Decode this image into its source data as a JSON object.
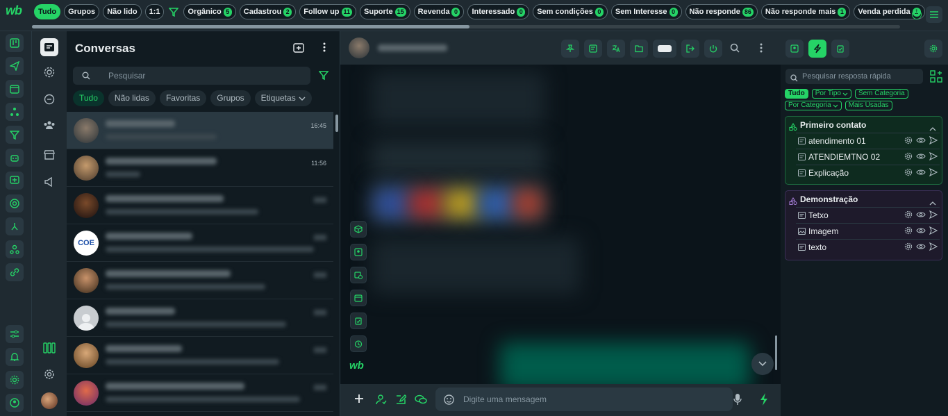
{
  "topbar": {
    "logo": "wb",
    "chips": [
      {
        "label": "Tudo",
        "count": "",
        "active": true
      },
      {
        "label": "Grupos",
        "count": ""
      },
      {
        "label": "Não lido",
        "count": ""
      },
      {
        "label": "1:1",
        "count": ""
      },
      {
        "label": "Orgânico",
        "count": "5"
      },
      {
        "label": "Cadastrou",
        "count": "2"
      },
      {
        "label": "Follow up",
        "count": "11"
      },
      {
        "label": "Suporte",
        "count": "15"
      },
      {
        "label": "Revenda",
        "count": "0"
      },
      {
        "label": "Interessado",
        "count": "0"
      },
      {
        "label": "Sem condições",
        "count": "0"
      },
      {
        "label": "Sem Interesse",
        "count": "0"
      },
      {
        "label": "Não responde",
        "count": "86"
      },
      {
        "label": "Não responde mais",
        "count": "1"
      },
      {
        "label": "Venda perdida",
        "count": "1"
      }
    ]
  },
  "conversations": {
    "title": "Conversas",
    "search_placeholder": "Pesquisar",
    "tabs": [
      {
        "label": "Tudo",
        "active": true
      },
      {
        "label": "Não lidas"
      },
      {
        "label": "Favoritas"
      },
      {
        "label": "Grupos"
      },
      {
        "label": "Etiquetas",
        "dropdown": true
      }
    ],
    "items": [
      {
        "time": "16:45",
        "selected": true,
        "w1": 100,
        "w2": 160
      },
      {
        "time": "11:56",
        "w1": 160,
        "w2": 50
      },
      {
        "time": "",
        "w1": 170,
        "w2": 220
      },
      {
        "time": "",
        "w1": 125,
        "w2": 300,
        "avatar_text": "COE"
      },
      {
        "time": "",
        "w1": 180,
        "w2": 230
      },
      {
        "time": "",
        "w1": 100,
        "w2": 260
      },
      {
        "time": "",
        "w1": 110,
        "w2": 250
      },
      {
        "time": "",
        "w1": 200,
        "w2": 280
      }
    ]
  },
  "composer": {
    "placeholder": "Digite uma mensagem"
  },
  "quick_replies": {
    "search_placeholder": "Pesquisar resposta rápida",
    "filters": [
      {
        "label": "Tudo",
        "active": true
      },
      {
        "label": "Por Tipo",
        "dropdown": true
      },
      {
        "label": "Sem Categoria"
      },
      {
        "label": "Por Categoria",
        "dropdown": true
      },
      {
        "label": "Mais Usadas"
      }
    ],
    "groups": [
      {
        "title": "Primeiro contato",
        "items": [
          {
            "label": "atendimento 01",
            "icon": "doc-icon"
          },
          {
            "label": "ATENDIEMTNO 02",
            "icon": "doc-icon"
          },
          {
            "label": "Explicação",
            "icon": "doc-icon"
          }
        ]
      },
      {
        "title": "Demonstração",
        "items": [
          {
            "label": "Tetxo",
            "icon": "doc-icon"
          },
          {
            "label": "Imagem",
            "icon": "image-icon"
          },
          {
            "label": "texto",
            "icon": "doc-icon"
          }
        ]
      }
    ]
  },
  "colors": {
    "accent": "#25d366",
    "bg": "#111b21",
    "panel": "#202c33"
  }
}
